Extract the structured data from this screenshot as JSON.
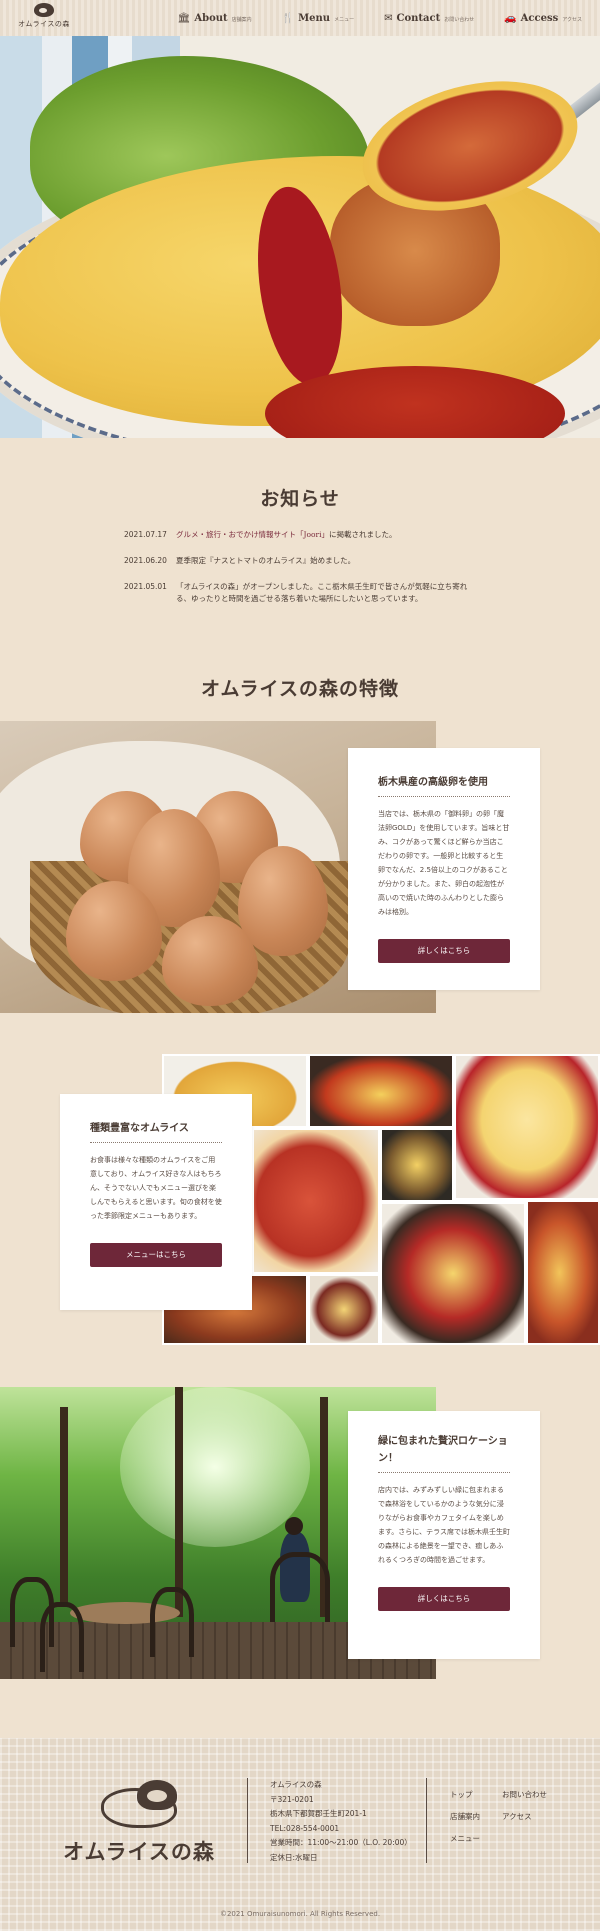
{
  "header": {
    "logo_text": "オムライスの森",
    "nav": [
      {
        "icon": "building-icon",
        "glyph": "🏛",
        "en": "About",
        "jp": "店舗案内"
      },
      {
        "icon": "fork-knife-icon",
        "glyph": "🍴",
        "en": "Menu",
        "jp": "メニュー"
      },
      {
        "icon": "envelope-icon",
        "glyph": "✉",
        "en": "Contact",
        "jp": "お問い合わせ"
      },
      {
        "icon": "car-icon",
        "glyph": "🚗",
        "en": "Access",
        "jp": "アクセス"
      }
    ]
  },
  "news": {
    "title": "お知らせ",
    "items": [
      {
        "date": "2021.07.17",
        "link": "グルメ・旅行・おでかけ情報サイト「Joori」",
        "text": "に掲載されました。"
      },
      {
        "date": "2021.06.20",
        "link": "",
        "text": "夏季限定『ナスとトマトのオムライス』始めました。"
      },
      {
        "date": "2021.05.01",
        "link": "",
        "text": "「オムライスの森」がオープンしました。ここ栃木県壬生町で皆さんが気軽に立ち寄れる、ゆったりと時間を過ごせる落ち着いた場所にしたいと思っています。"
      }
    ]
  },
  "features": {
    "title": "オムライスの森の特徴",
    "eggs": {
      "heading": "栃木県産の高級卵を使用",
      "body": "当店では、栃木県の「御料卵」の卵「魔法卵GOLD」を使用しています。旨味と甘み、コクがあって驚くほど鮮らか当店こだわりの卵です。一般卵と比較すると生卵でなんだ、2.5倍以上のコクがあることが分かりました。また、卵白の起泡性が高いので焼いた時のふんわりとした膨らみは格別。",
      "button": "詳しくはこちら"
    },
    "variety": {
      "heading": "種類豊富なオムライス",
      "body": "お食事は様々な種類のオムライスをご用意しており、オムライス好きな人はもちろん、そうでない人でもメニュー選びを楽しんでもらえると思います。旬の食材を使った季節限定メニューもあります。",
      "button": "メニューはこちら"
    },
    "location": {
      "heading": "緑に包まれた贅沢ロケーション！",
      "body": "店内では、みずみずしい緑に包まれまるで森林浴をしているかのような気分に浸りながらお食事やカフェタイムを楽しめます。さらに、テラス席では栃木県壬生町の森林による絶景を一望でき、癒しあふれるくつろぎの時間を過ごせます。",
      "button": "詳しくはこちら"
    }
  },
  "footer": {
    "logo_text": "オムライスの森",
    "info": [
      "オムライスの森",
      "〒321-0201",
      "栃木県下都賀郡壬生町201-1",
      "TEL:028-554-0001",
      "営業時間：11:00〜21:00（L.O. 20:00）",
      "定休日:水曜日"
    ],
    "links": [
      "トップ",
      "お問い合わせ",
      "店舗案内",
      "アクセス",
      "メニュー"
    ],
    "copyright": "©2021 Omuraisunomori. All Rights Reserved."
  },
  "colors": {
    "accent": "#6e2739",
    "background": "#efe2d0",
    "text": "#4a3c34"
  }
}
